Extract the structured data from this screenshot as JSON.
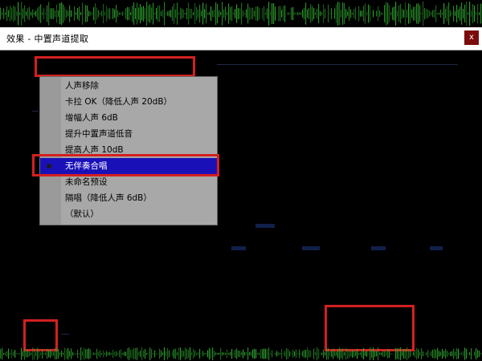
{
  "window": {
    "title": "效果 - 中置声道提取",
    "close_label": "x"
  },
  "preset_dropdown": {
    "items": [
      {
        "label": "人声移除",
        "selected": false
      },
      {
        "label": "卡拉 OK（降低人声 20dB）",
        "selected": false
      },
      {
        "label": "增幅人声 6dB",
        "selected": false
      },
      {
        "label": "提升中置声道低音",
        "selected": false
      },
      {
        "label": "提高人声 10dB",
        "selected": false
      },
      {
        "label": "无伴奏合唱",
        "selected": true
      },
      {
        "label": "未命名预设",
        "selected": false
      },
      {
        "label": "隔唱（降低人声 6dB）",
        "selected": false
      },
      {
        "label": "（默认）",
        "selected": false
      }
    ]
  },
  "icons": {
    "selected_marker": "bullet-icon"
  },
  "colors": {
    "highlight": "#d42020",
    "selection": "#1a10b8",
    "waveform": "#2fa22f"
  }
}
